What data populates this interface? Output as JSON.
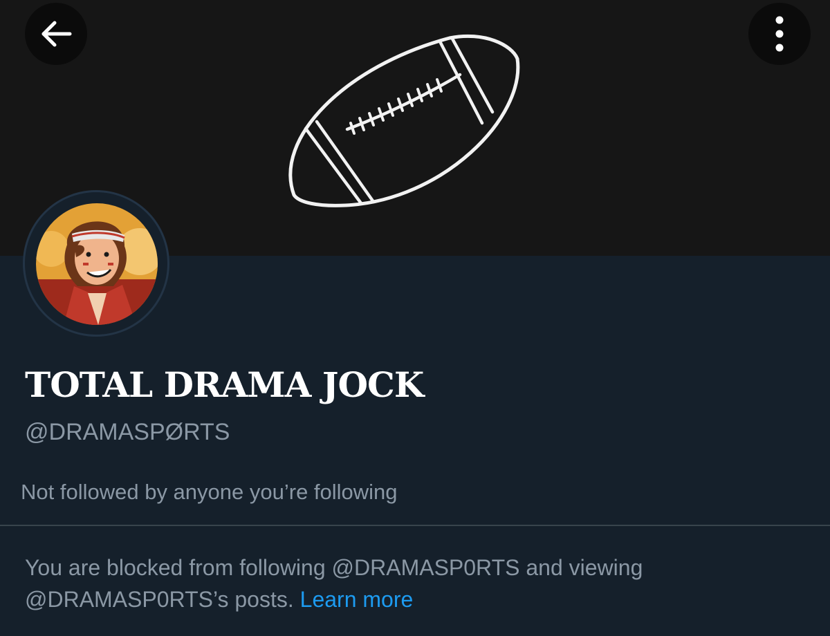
{
  "header": {
    "back_icon": "arrow-left-icon",
    "more_icon": "more-vertical-icon",
    "banner_image": "american-football-outline"
  },
  "profile": {
    "display_name": "TOTAL DRAMA JOCK",
    "handle": "@DRAMASPØRTS",
    "followed_by": "Not followed by anyone you’re following"
  },
  "notice": {
    "text_1": "You are blocked from following @DRAMASP0RTS and viewing",
    "text_2": "@DRAMASP0RTS’s posts.",
    "link_label": "Learn more"
  },
  "colors": {
    "background": "#15202b",
    "banner": "#161616",
    "secondary_text": "#8b98a5",
    "link": "#1d9bf0"
  }
}
